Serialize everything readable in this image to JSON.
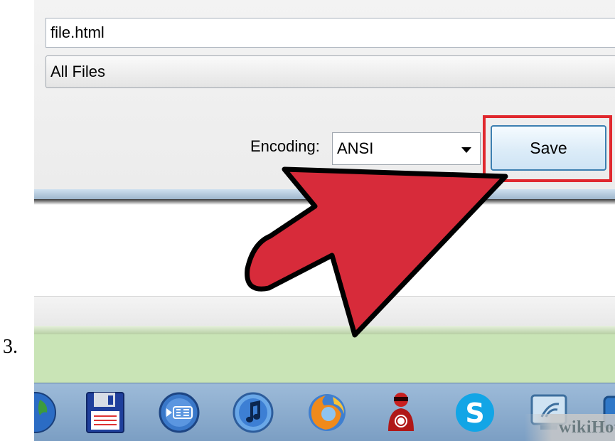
{
  "step": {
    "number": "3."
  },
  "dialog": {
    "filename_value": "file.html",
    "save_as_type_value": "All Files",
    "encoding_label": "Encoding:",
    "encoding_value": "ANSI",
    "save_label": "Save"
  },
  "watermark": {
    "text": "wikiHow"
  },
  "taskbar": {
    "icons": [
      "globe-icon",
      "floppy-disk-icon",
      "bbs-icon",
      "itunes-icon",
      "firefox-icon",
      "spy-agent-icon",
      "skype-icon",
      "network-icon"
    ]
  },
  "colors": {
    "highlight": "#e0282e",
    "arrow": "#d72b3a"
  }
}
